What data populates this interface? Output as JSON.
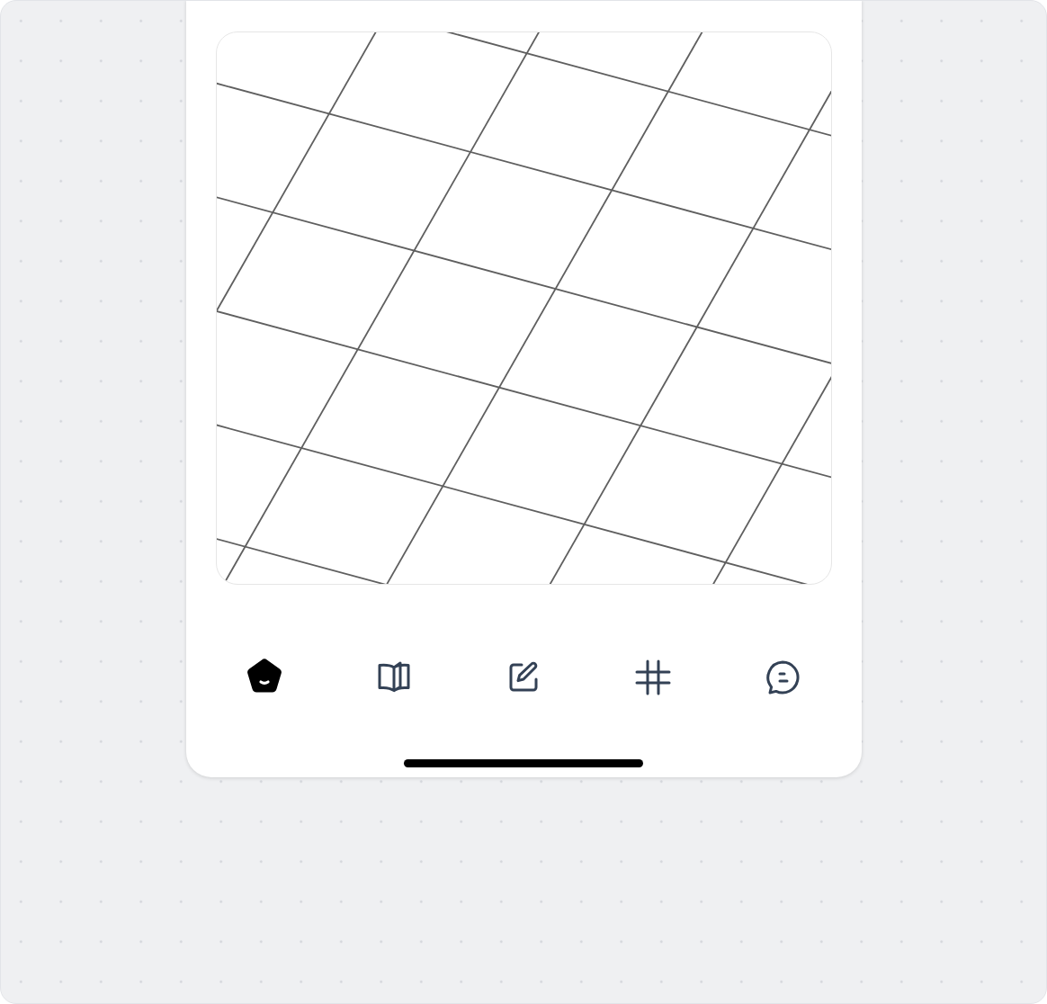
{
  "tab_bar": {
    "items": [
      {
        "kind": "home",
        "selected": true
      },
      {
        "kind": "book",
        "selected": false
      },
      {
        "kind": "edit",
        "selected": false
      },
      {
        "kind": "hash",
        "selected": false
      },
      {
        "kind": "chat",
        "selected": false
      }
    ]
  }
}
